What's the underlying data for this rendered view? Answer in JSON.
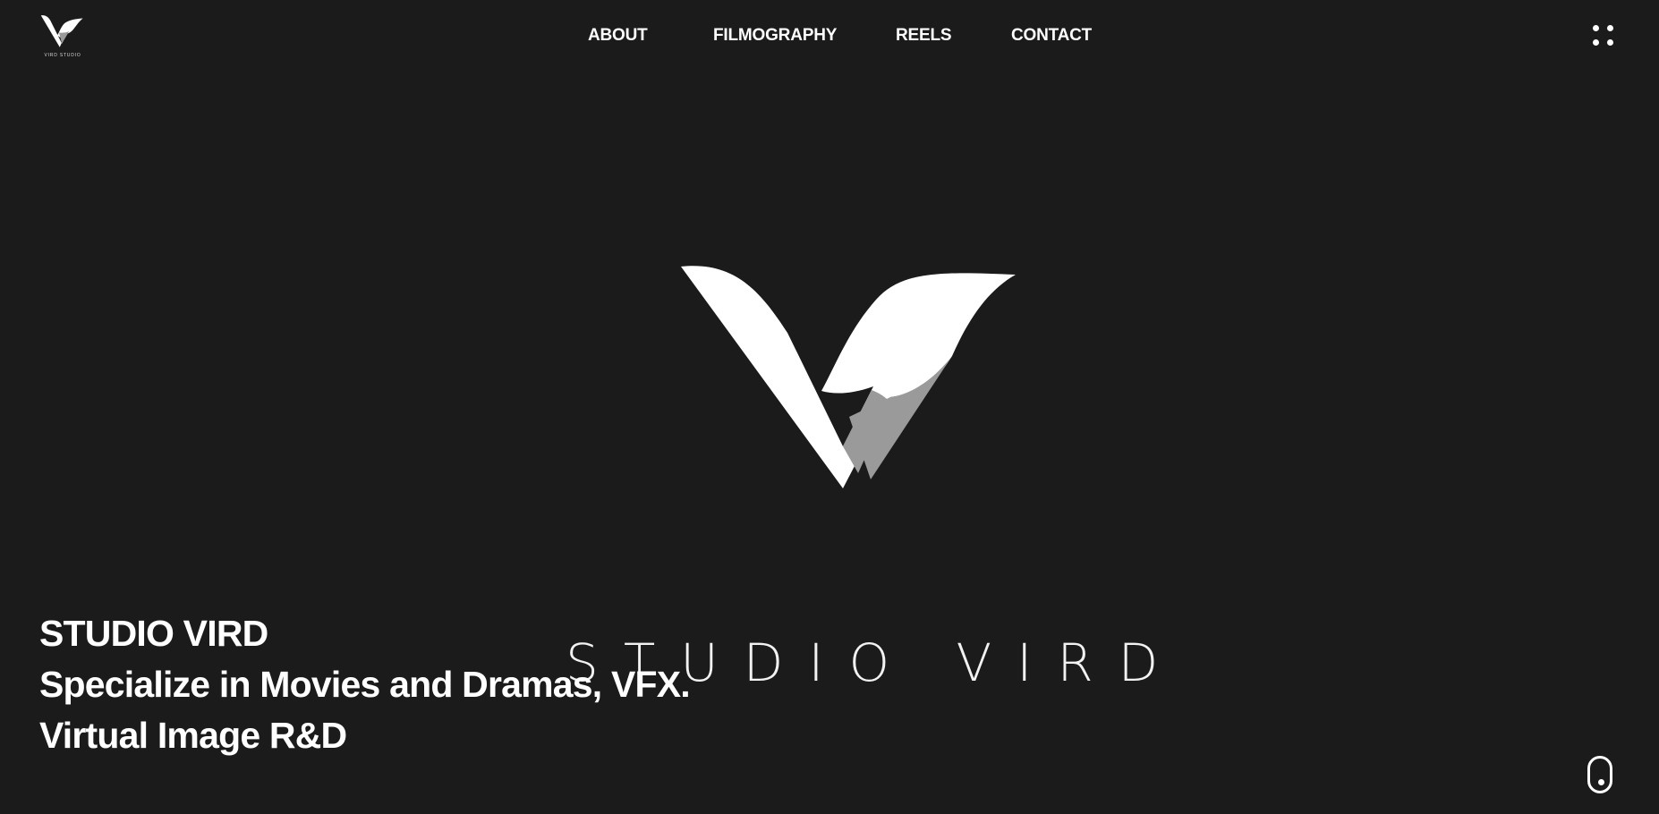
{
  "header": {
    "logo": {
      "icon": "v-logo-icon",
      "caption": "VIRD STUDIO"
    },
    "nav": [
      {
        "label": "ABOUT"
      },
      {
        "label": "FILMOGRAPHY"
      },
      {
        "label": "REELS"
      },
      {
        "label": "CONTACT"
      }
    ],
    "menu_icon": "grid-dots-icon"
  },
  "hero": {
    "logo_icon": "v-logo-icon",
    "wordmark": "STUDIO VIRD",
    "lines": [
      "STUDIO VIRD",
      "Specialize in Movies and Dramas, VFX.",
      "Virtual Image R&D"
    ]
  },
  "scroll_icon": "mouse-scroll-icon",
  "colors": {
    "background": "#1b1b1b",
    "text": "#ffffff",
    "logo_shadow": "#9a9a9a"
  }
}
